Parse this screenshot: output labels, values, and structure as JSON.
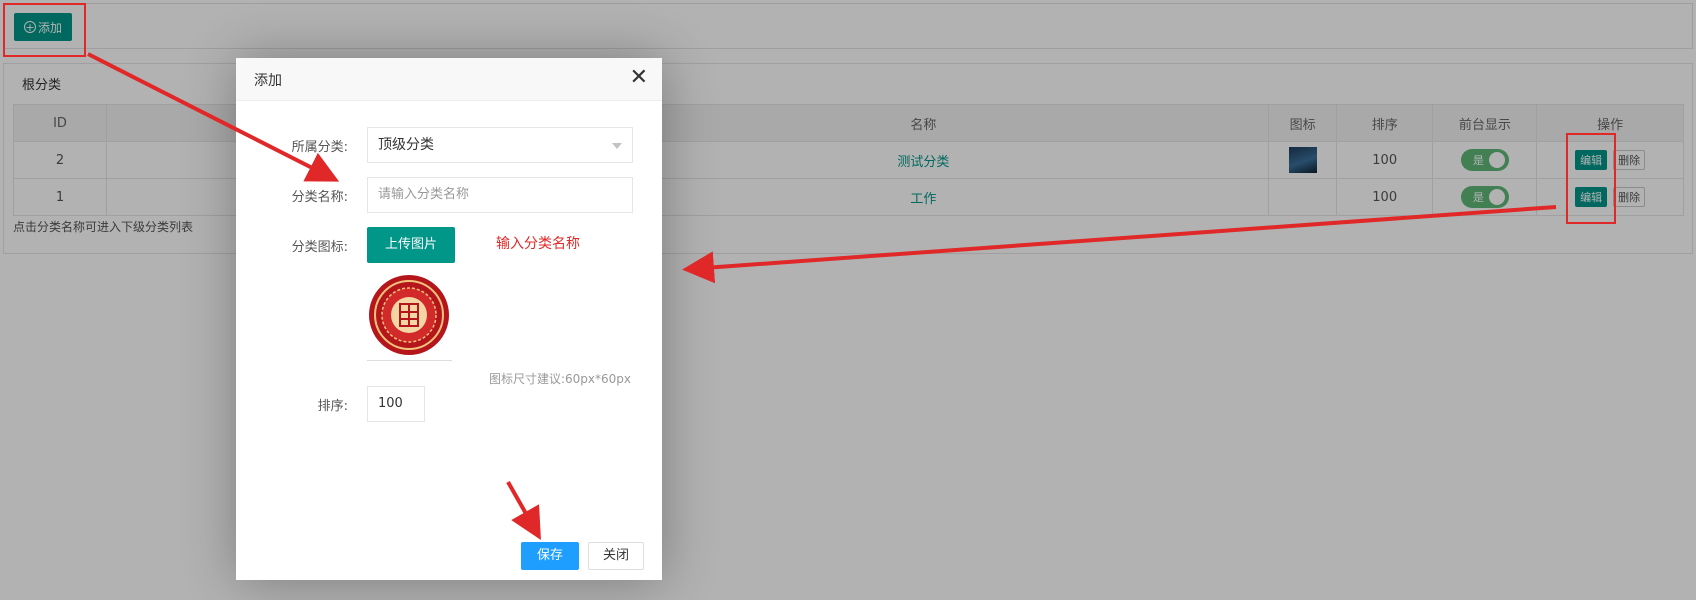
{
  "toolbar": {
    "add_label": "添加",
    "add_icon": "plus-circle-icon"
  },
  "panel": {
    "title": "根分类",
    "columns": [
      "ID",
      "",
      "名称",
      "图标",
      "排序",
      "前台显示",
      "操作"
    ],
    "rows": [
      {
        "id": "2",
        "name": "测试分类",
        "has_icon": true,
        "sort": "100",
        "visible": "是",
        "edit": "编辑",
        "delete": "删除"
      },
      {
        "id": "1",
        "name": "工作",
        "has_icon": false,
        "sort": "100",
        "visible": "是",
        "edit": "编辑",
        "delete": "删除"
      }
    ],
    "hint": "点击分类名称可进入下级分类列表"
  },
  "modal": {
    "title": "添加",
    "close_icon": "close-icon",
    "parent_label": "所属分类:",
    "parent_value": "顶级分类",
    "name_label": "分类名称:",
    "name_placeholder": "请输入分类名称",
    "icon_label": "分类图标:",
    "upload_label": "上传图片",
    "icon_size_hint": "图标尺寸建议:60px*60px",
    "sort_label": "排序:",
    "sort_value": "100",
    "save_label": "保存",
    "close_label": "关闭"
  },
  "annotation": {
    "note": "输入分类名称",
    "color": "#e02828"
  },
  "colors": {
    "primary": "#009688",
    "save": "#1e9fff",
    "switch_on": "#5fb878"
  }
}
